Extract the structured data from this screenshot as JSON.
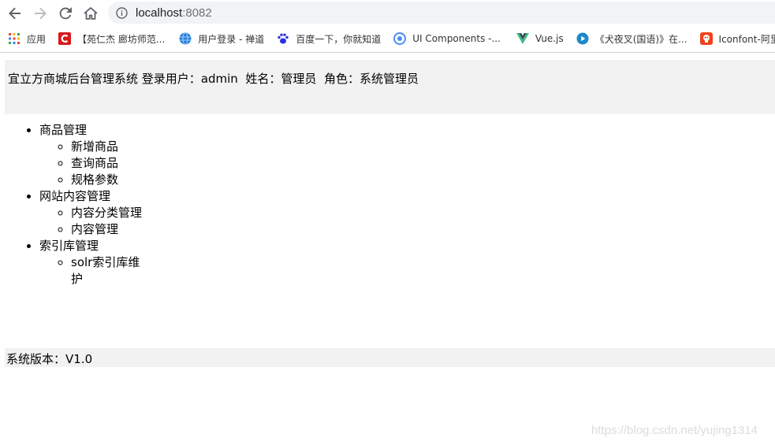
{
  "browser": {
    "url_host": "localhost",
    "url_port": ":8082",
    "bookmarks": [
      {
        "label": "应用",
        "icon": "apps-grid-icon",
        "color": "#1a73e8"
      },
      {
        "label": "【苑仁杰 廊坊师范...",
        "icon": "csdn-logo-icon",
        "color": "#d71a1b"
      },
      {
        "label": "用户登录 - 禅道",
        "icon": "globe-icon",
        "color": "#2b7fd6"
      },
      {
        "label": "百度一下，你就知道",
        "icon": "baidu-paw-icon",
        "color": "#2932e1"
      },
      {
        "label": "UI Components -...",
        "icon": "circle-target-icon",
        "color": "#4a8df8"
      },
      {
        "label": "Vue.js",
        "icon": "vue-logo-icon",
        "color": "#41b883"
      },
      {
        "label": "《犬夜叉(国语)》在...",
        "icon": "video-play-icon",
        "color": "#1e88c8"
      },
      {
        "label": "Iconfont-阿里巴巴矢量图标库",
        "icon": "iconfont-logo-icon",
        "color": "#f0421c"
      }
    ]
  },
  "header": {
    "system_name": "宜立方商城后台管理系统",
    "login_label": "登录用户：",
    "login_user": "admin",
    "name_label": "姓名：",
    "name_value": "管理员",
    "role_label": "角色：",
    "role_value": "系统管理员"
  },
  "menu": [
    {
      "label": "商品管理",
      "children": [
        "新增商品",
        "查询商品",
        "规格参数"
      ]
    },
    {
      "label": "网站内容管理",
      "children": [
        "内容分类管理",
        "内容管理"
      ]
    },
    {
      "label": "索引库管理",
      "children": [
        "solr索引库维护"
      ]
    }
  ],
  "footer": {
    "version_label": "系统版本：",
    "version_value": "V1.0"
  },
  "watermark": "https://blog.csdn.net/yujing1314"
}
